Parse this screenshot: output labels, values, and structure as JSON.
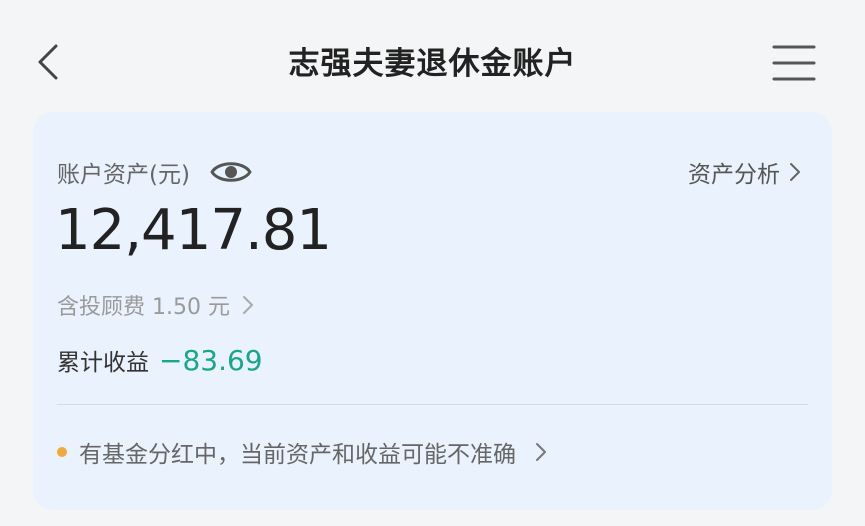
{
  "header": {
    "title": "志强夫妻退休金账户",
    "back_icon": "chevron-left-icon",
    "menu_icon": "menu-icon"
  },
  "card": {
    "assets_label": "账户资产(元)",
    "eye_icon": "eye-icon",
    "analysis_link": "资产分析",
    "amount": "12,417.81",
    "fee_text": "含投顾费 1.50 元",
    "return_label": "累计收益",
    "return_value": "−83.69",
    "notice_text": "有基金分红中，当前资产和收益可能不准确"
  },
  "colors": {
    "card_background": "#e9f2fd",
    "positive_return": "#19a68a",
    "notice_dot": "#f0a93a"
  }
}
